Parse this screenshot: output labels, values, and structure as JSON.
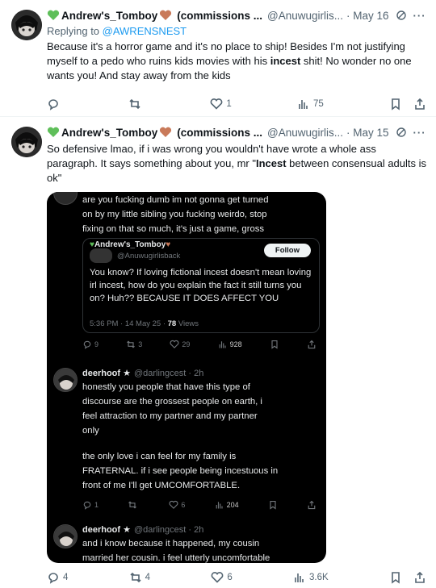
{
  "colors": {
    "accent": "#1d9bf0",
    "heart_green": "#5fbf5a",
    "heart_brown": "#c97a5a",
    "muted": "#536471"
  },
  "tweet1": {
    "name": "Andrew's_Tomboy",
    "name_suffix": "(commissions ...",
    "handle": "@Anuwugirlis...",
    "date": "· May 16",
    "replying_prefix": "Replying to ",
    "replying_to": "@AWRENSNEST",
    "text_before": "Because it's a horror game and it's no place to ship! Besides I'm not justifying myself to a pedo who ruins kids movies with his ",
    "text_bold": "incest",
    "text_after": " shit! No wonder no one wants you! And stay away from the kids",
    "replies": "",
    "reposts": "",
    "likes": "1",
    "views": "75"
  },
  "tweet2": {
    "name": "Andrew's_Tomboy",
    "name_suffix": "(commissions ...",
    "handle": "@Anuwugirlis...",
    "date": "· May 15",
    "text_before": "So defensive lmao, if i was wrong you wouldn't have wrote a whole ass paragraph. It says something about you, mr \"",
    "text_bold": "Incest",
    "text_after": " between consensual adults is ok\"",
    "replies": "4",
    "reposts": "4",
    "likes": "6",
    "views": "3.6K"
  },
  "media": {
    "top_line1": "are you fucking dumb im not gonna get turned",
    "top_line2": "on by my little sibling you fucking weirdo, stop",
    "top_line3": "fixing on that so much, it's just a game, gross",
    "quote": {
      "name": "Andrew's_Tomboy",
      "handle": "@Anuwugirlisback",
      "follow": "Follow",
      "text": "You know? If loving fictional incest doesn't mean loving irl incest, how do you explain the fact it still turns you on? Huh?? BECAUSE IT DOES AFFECT YOU",
      "meta": "5:36 PM · 14 May 25 · ",
      "views": "78",
      "views_label": " Views"
    },
    "row1": {
      "replies": "9",
      "reposts": "3",
      "likes": "29",
      "views": "928"
    },
    "post1": {
      "name": "deerhoof ★",
      "handle": "@darlingcest · 2h",
      "lines": [
        "honestly you people that have this type of",
        "discourse are the grossest people on earth, i",
        "feel attraction to my partner and my partner",
        "only",
        "",
        "the only love i can feel for my family is",
        "FRATERNAL. if i see people being incestuous in",
        "front of me I'll get UMCOMFORTABLE."
      ]
    },
    "row2": {
      "replies": "1",
      "reposts": "",
      "likes": "6",
      "views": "204"
    },
    "post2": {
      "name": "deerhoof ★",
      "handle": "@darlingcest · 2h",
      "line1": "and i know because it happened, my cousin",
      "line2": "married her cousin. i feel utterly uncomfortable"
    }
  }
}
